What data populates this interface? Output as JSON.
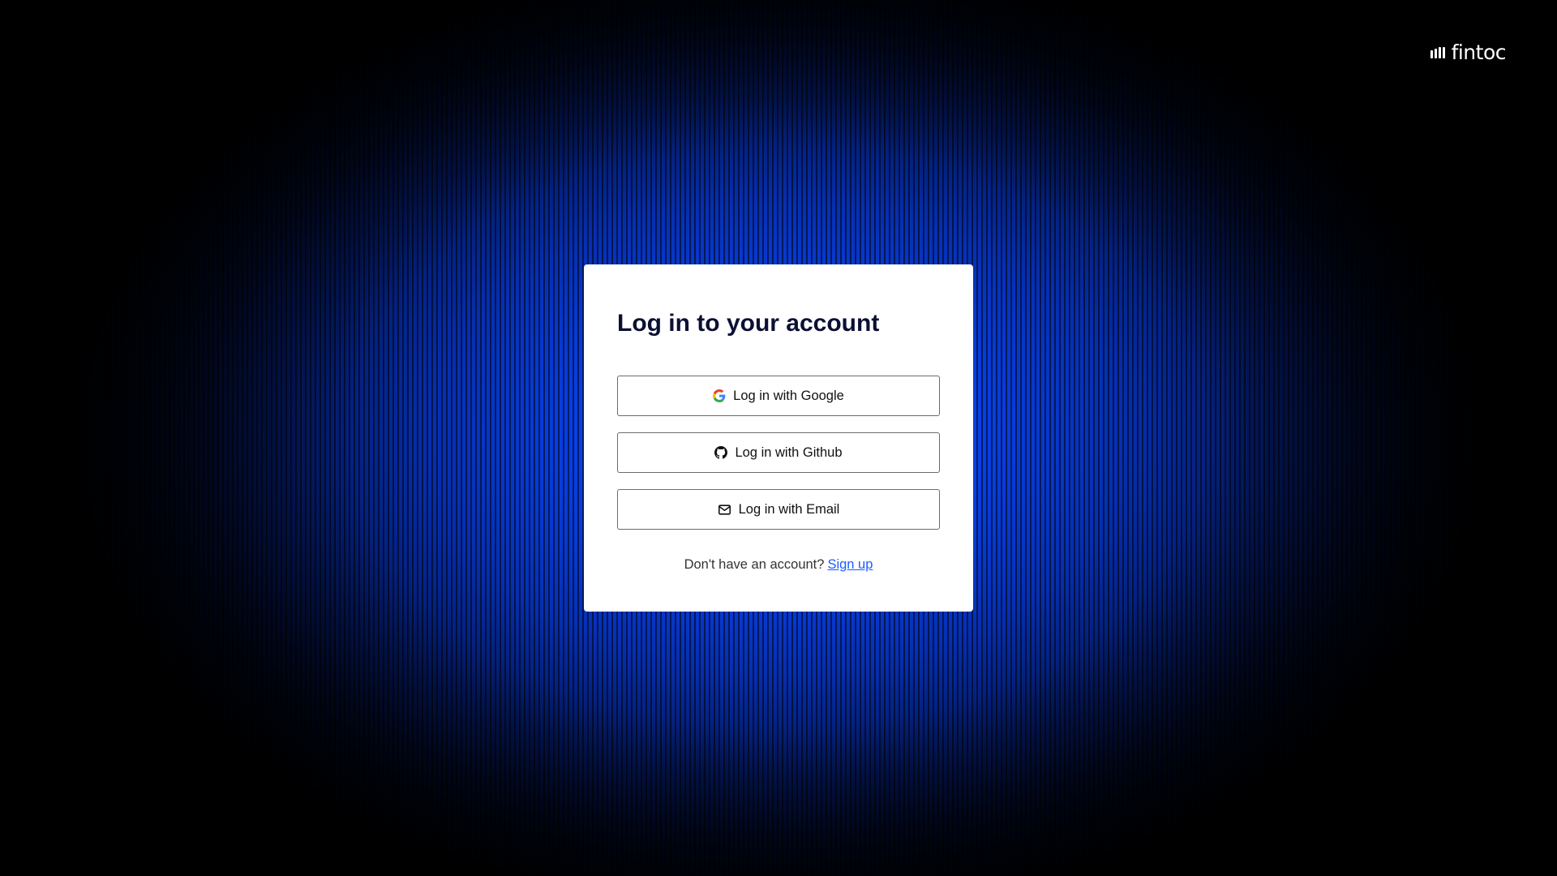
{
  "brand": {
    "name": "fintoc"
  },
  "login": {
    "title": "Log in to your account",
    "google_label": "Log in with Google",
    "github_label": "Log in with Github",
    "email_label": "Log in with Email",
    "signup_prompt": "Don't have an account?",
    "signup_link": "Sign up"
  },
  "icons": {
    "brand": "fintoc-logo-bars-icon",
    "google": "google-icon",
    "github": "github-icon",
    "email": "mail-icon"
  },
  "colors": {
    "background_glow": "#0a4cff",
    "title": "#0b1033",
    "link": "#1a5cff",
    "button_border": "#6b6b6b"
  }
}
